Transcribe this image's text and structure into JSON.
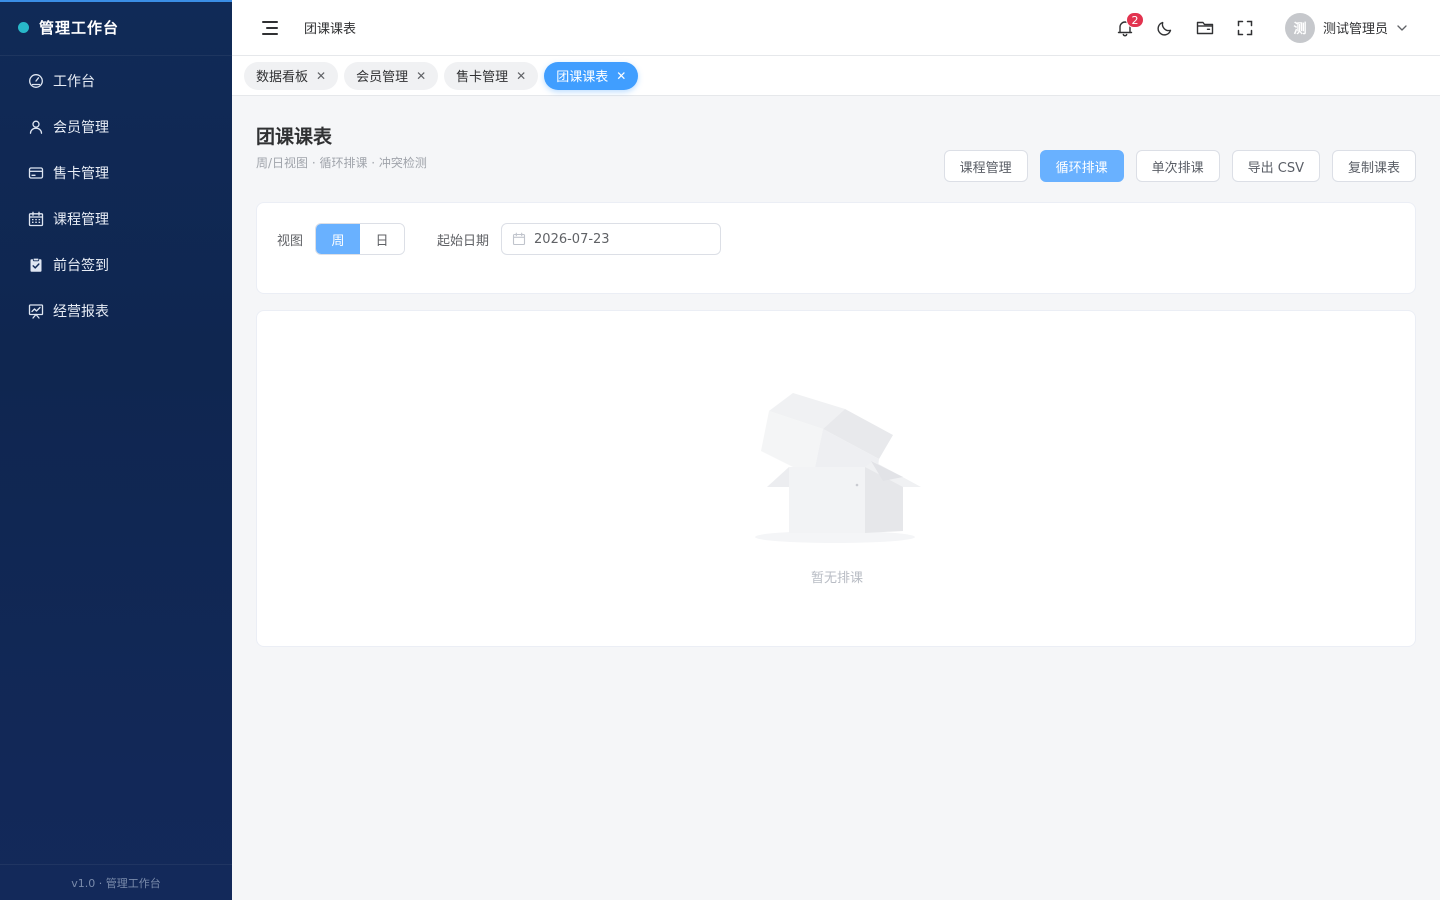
{
  "sidebar": {
    "brand": "管理工作台",
    "items": [
      {
        "label": "工作台",
        "icon": "dashboard-icon"
      },
      {
        "label": "会员管理",
        "icon": "user-icon"
      },
      {
        "label": "售卡管理",
        "icon": "card-icon"
      },
      {
        "label": "课程管理",
        "icon": "calendar-icon"
      },
      {
        "label": "前台签到",
        "icon": "checkin-icon"
      },
      {
        "label": "经营报表",
        "icon": "report-icon"
      }
    ],
    "footer": "v1.0 · 管理工作台"
  },
  "header": {
    "breadcrumb": "团课课表",
    "notification_count": "2",
    "icons": [
      "bell-icon",
      "moon-icon",
      "folder-icon",
      "fullscreen-icon"
    ],
    "user": {
      "avatar_text": "测",
      "name": "测试管理员"
    }
  },
  "tabs": [
    {
      "label": "数据看板",
      "active": false
    },
    {
      "label": "会员管理",
      "active": false
    },
    {
      "label": "售卡管理",
      "active": false
    },
    {
      "label": "团课课表",
      "active": true
    }
  ],
  "page": {
    "title": "团课课表",
    "subtitle": "周/日视图 · 循环排课 · 冲突检测",
    "actions": [
      {
        "label": "课程管理",
        "primary": false
      },
      {
        "label": "循环排课",
        "primary": true
      },
      {
        "label": "单次排课",
        "primary": false
      },
      {
        "label": "导出 CSV",
        "primary": false
      },
      {
        "label": "复制课表",
        "primary": false
      }
    ]
  },
  "filters": {
    "view_label": "视图",
    "view_options": [
      {
        "label": "周",
        "active": true
      },
      {
        "label": "日",
        "active": false
      }
    ],
    "start_date_label": "起始日期",
    "start_date_value": "2026-07-23"
  },
  "empty": {
    "text": "暂无排课"
  },
  "colors": {
    "sidebar_bg": "#102a57",
    "accent": "#409eff",
    "primary_button": "#69b1ff",
    "badge": "#e2334f"
  }
}
